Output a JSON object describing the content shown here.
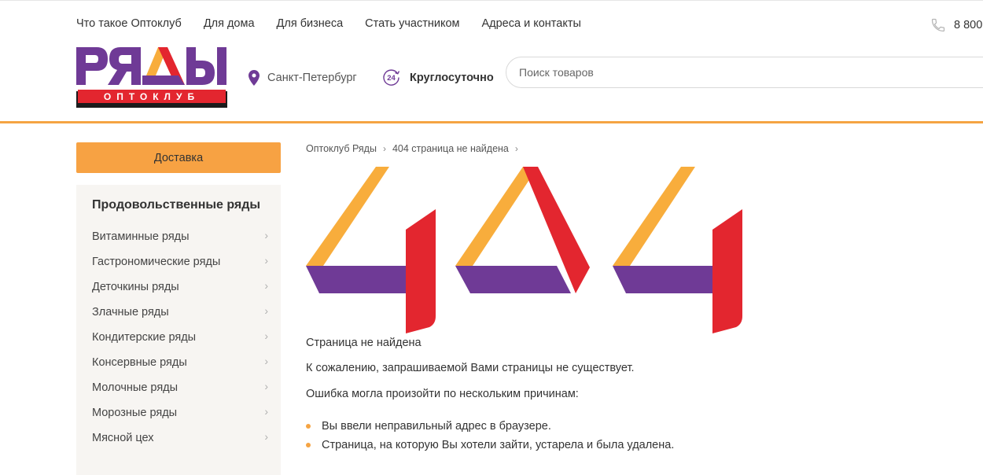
{
  "top_nav": [
    {
      "label": "Что такое Оптоклуб"
    },
    {
      "label": "Для дома"
    },
    {
      "label": "Для бизнеса"
    },
    {
      "label": "Стать участником"
    },
    {
      "label": "Адреса и контакты"
    }
  ],
  "phone": "8 800",
  "logo": {
    "word": "РЯДЫ",
    "sub": "ОПТОКЛУБ"
  },
  "city": "Санкт-Петербург",
  "hours": {
    "badge": "24",
    "label": "Круглосуточно"
  },
  "search": {
    "placeholder": "Поиск товаров"
  },
  "sidebar": {
    "delivery_label": "Доставка",
    "catalog_title": "Продовольственные ряды",
    "items": [
      {
        "label": "Витаминные ряды"
      },
      {
        "label": "Гастрономические ряды"
      },
      {
        "label": "Деточкины ряды"
      },
      {
        "label": "Злачные ряды"
      },
      {
        "label": "Кондитерские ряды"
      },
      {
        "label": "Консервные ряды"
      },
      {
        "label": "Молочные ряды"
      },
      {
        "label": "Морозные ряды"
      },
      {
        "label": "Мясной цех"
      }
    ]
  },
  "breadcrumb": [
    {
      "label": "Оптоклуб Ряды"
    },
    {
      "label": "404 страница не найдена"
    }
  ],
  "error": {
    "code": "404",
    "title": "Страница не найдена",
    "message": "К сожалению, запрашиваемой Вами страницы не существует.",
    "reasons_intro": "Ошибка могла произойти по нескольким причинам:",
    "reasons": [
      "Вы ввели неправильный адрес в браузере.",
      "Страница, на которую Вы хотели зайти, устарела и была удалена."
    ]
  },
  "colors": {
    "orange": "#f7a243",
    "purple": "#6f3a96",
    "red": "#e3262f",
    "yellow": "#f8ad3c"
  }
}
